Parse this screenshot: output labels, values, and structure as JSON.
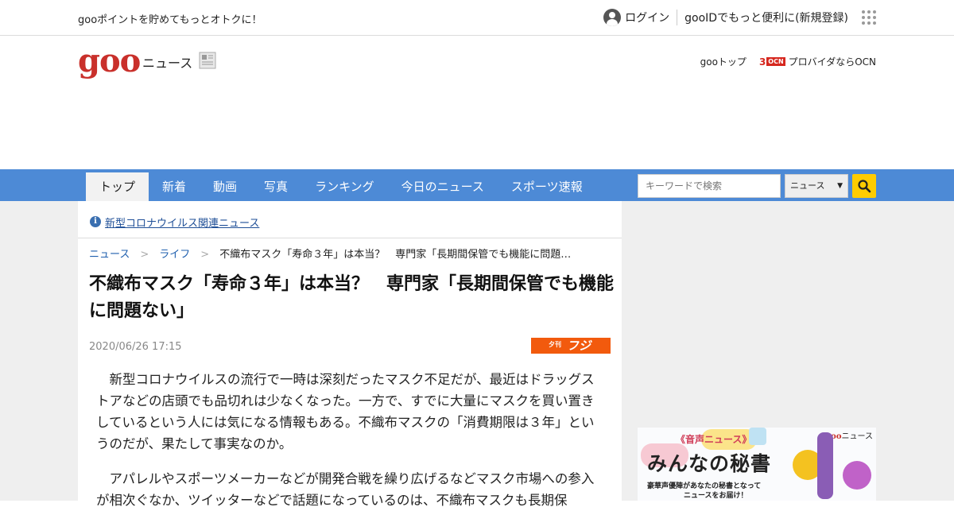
{
  "utility_bar": {
    "promo_text": "gooポイントを貯めてもっとオトクに！",
    "login_label": "ログイン",
    "register_label": "gooIDでもっと便利に(新規登録)"
  },
  "header": {
    "logo_text": "goo",
    "section_name": "ニュース",
    "goo_top_link": "gooトップ",
    "ocn_mark": "3",
    "ocn_badge": "OCN",
    "ocn_link": "プロバイダならOCN"
  },
  "nav": {
    "tabs": [
      "トップ",
      "新着",
      "動画",
      "写真",
      "ランキング",
      "今日のニュース",
      "スポーツ速報"
    ],
    "active_tab": "トップ",
    "search_placeholder": "キーワードで検索",
    "search_scope": "ニュース"
  },
  "article": {
    "covid_link": "新型コロナウイルス関連ニュース",
    "breadcrumb": [
      "ニュース",
      "ライフ",
      "不織布マスク「寿命３年」は本当？　専門家「長期間保管でも機能に問題…"
    ],
    "title": "不織布マスク「寿命３年」は本当？　専門家「長期間保管でも機能に問題ない」",
    "date": "2020/06/26 17:15",
    "source_small": "夕刊",
    "source_big": "フジ",
    "paragraphs": [
      "新型コロナウイルスの流行で一時は深刻だったマスク不足だが、最近はドラッグストアなどの店頭でも品切れは少なくなった。一方で、すでに大量にマスクを買い置きしているという人には気になる情報もある。不織布マスクの「消費期限は３年」というのだが、果たして事実なのか。",
      "アパレルやスポーツメーカーなどが開発合戦を繰り広げるなどマスク市場への参入が相次ぐなか、ツイッターなどで話題になっているのは、不織布マスクも長期保"
    ]
  },
  "ad": {
    "label": "《音声ニュース》",
    "headline": "みんなの秘書",
    "sub1": "豪華声優陣があなたの秘書となって",
    "sub2": "ニュースをお届け！",
    "brand_logo": "goo",
    "brand_suffix": "ニュース"
  },
  "colors": {
    "nav_blue": "#4d8ad6",
    "goo_red": "#c9302b",
    "search_button_yellow": "#ffcc00",
    "source_orange": "#f25a0d",
    "link_blue": "#1f5fae"
  }
}
